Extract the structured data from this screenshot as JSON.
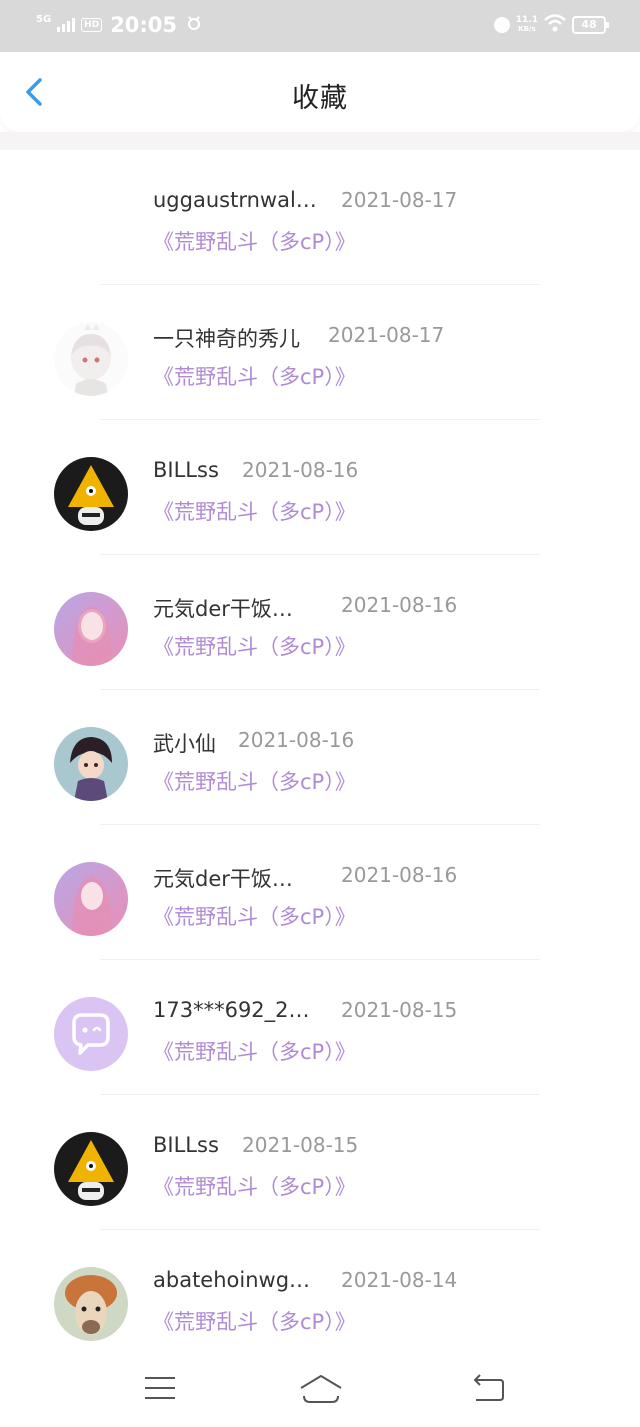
{
  "status_bar": {
    "network": "5G",
    "hd": "HD",
    "time": "20:05",
    "speed_value": "11.1",
    "speed_unit": "KB/s",
    "battery": "48"
  },
  "header": {
    "title": "收藏",
    "back_icon": "chevron-left-icon"
  },
  "colors": {
    "accent_blue": "#3a9be8",
    "work_purple": "#b08bd4",
    "date_gray": "#999999"
  },
  "items": [
    {
      "name": "uggaustrnwal…",
      "date": "2021-08-17",
      "work": "《荒野乱斗（多cP）》",
      "avatar": "none"
    },
    {
      "name": "一只神奇的秀儿",
      "date": "2021-08-17",
      "work": "《荒野乱斗（多cP）》",
      "avatar": "anime-white-hair"
    },
    {
      "name": "BILLss",
      "date": "2021-08-16",
      "work": "《荒野乱斗（多cP）》",
      "avatar": "bill-triangle"
    },
    {
      "name": "元気der干饭…",
      "date": "2021-08-16",
      "work": "《荒野乱斗（多cP）》",
      "avatar": "pink-hair-girl"
    },
    {
      "name": "武小仙",
      "date": "2021-08-16",
      "work": "《荒野乱斗（多cP）》",
      "avatar": "anime-boy"
    },
    {
      "name": "元気der干饭…",
      "date": "2021-08-16",
      "work": "《荒野乱斗（多cP）》",
      "avatar": "pink-hair-girl"
    },
    {
      "name": "173***692_2…",
      "date": "2021-08-15",
      "work": "《荒野乱斗（多cP）》",
      "avatar": "default-chat-bubble"
    },
    {
      "name": "BILLss",
      "date": "2021-08-15",
      "work": "《荒野乱斗（多cP）》",
      "avatar": "bill-triangle"
    },
    {
      "name": "abatehoinwg…",
      "date": "2021-08-14",
      "work": "《荒野乱斗（多cP）》",
      "avatar": "alpaca"
    }
  ],
  "nav": {
    "menu_icon": "menu-icon",
    "home_icon": "home-icon",
    "back_icon": "back-icon"
  }
}
